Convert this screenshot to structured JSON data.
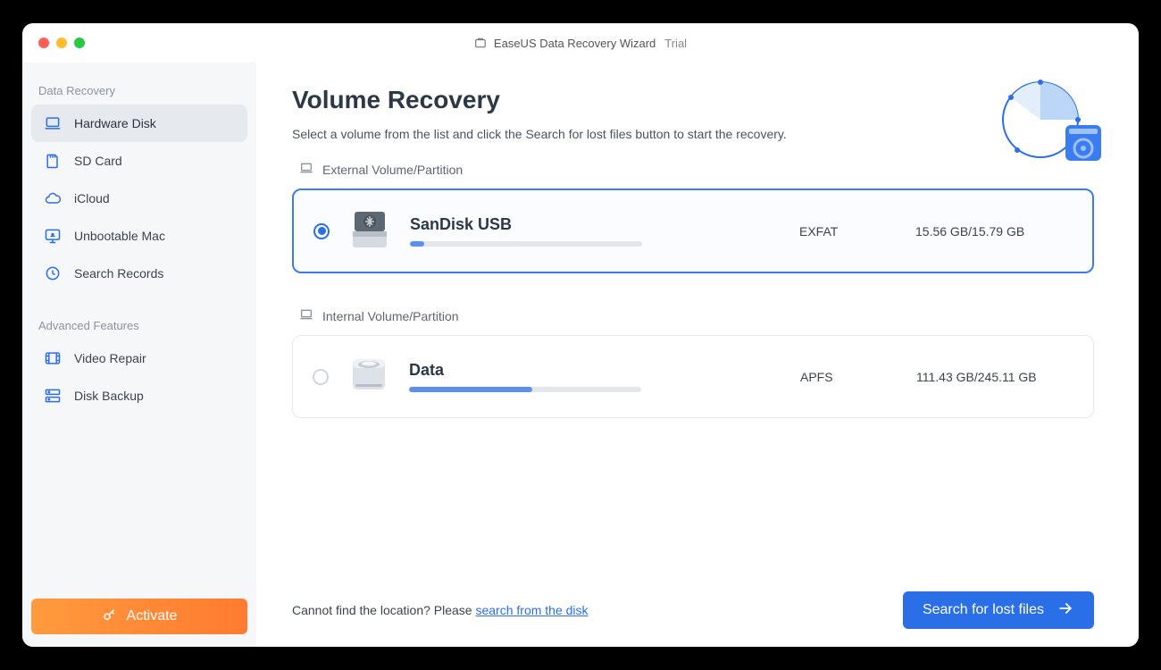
{
  "titlebar": {
    "app_name": "EaseUS Data Recovery Wizard",
    "suffix": "Trial"
  },
  "sidebar": {
    "section1_title": "Data Recovery",
    "section2_title": "Advanced Features",
    "items": [
      {
        "label": "Hardware Disk",
        "icon": "laptop-icon",
        "active": true
      },
      {
        "label": "SD Card",
        "icon": "sdcard-icon",
        "active": false
      },
      {
        "label": "iCloud",
        "icon": "cloud-icon",
        "active": false
      },
      {
        "label": "Unbootable Mac",
        "icon": "monitor-icon",
        "active": false
      },
      {
        "label": "Search Records",
        "icon": "clock-icon",
        "active": false
      }
    ],
    "advanced_items": [
      {
        "label": "Video Repair",
        "icon": "video-icon"
      },
      {
        "label": "Disk Backup",
        "icon": "backup-icon"
      }
    ],
    "activate_label": "Activate"
  },
  "page": {
    "title": "Volume Recovery",
    "subtitle": "Select a volume from the list and click the Search for lost files button to start the recovery."
  },
  "sections": {
    "external": "External Volume/Partition",
    "internal": "Internal Volume/Partition"
  },
  "volumes": {
    "external": [
      {
        "name": "SanDisk USB",
        "format": "EXFAT",
        "used": "15.56 GB",
        "total": "15.79 GB",
        "size_text": "15.56 GB/15.79 GB",
        "fill_percent": 6,
        "selected": true
      }
    ],
    "internal": [
      {
        "name": "Data",
        "format": "APFS",
        "used": "111.43 GB",
        "total": "245.11 GB",
        "size_text": "111.43 GB/245.11 GB",
        "fill_percent": 53,
        "selected": false
      }
    ]
  },
  "footer": {
    "hint_prefix": "Cannot find the location? Please ",
    "hint_link": "search from the disk",
    "search_btn": "Search for lost files"
  }
}
